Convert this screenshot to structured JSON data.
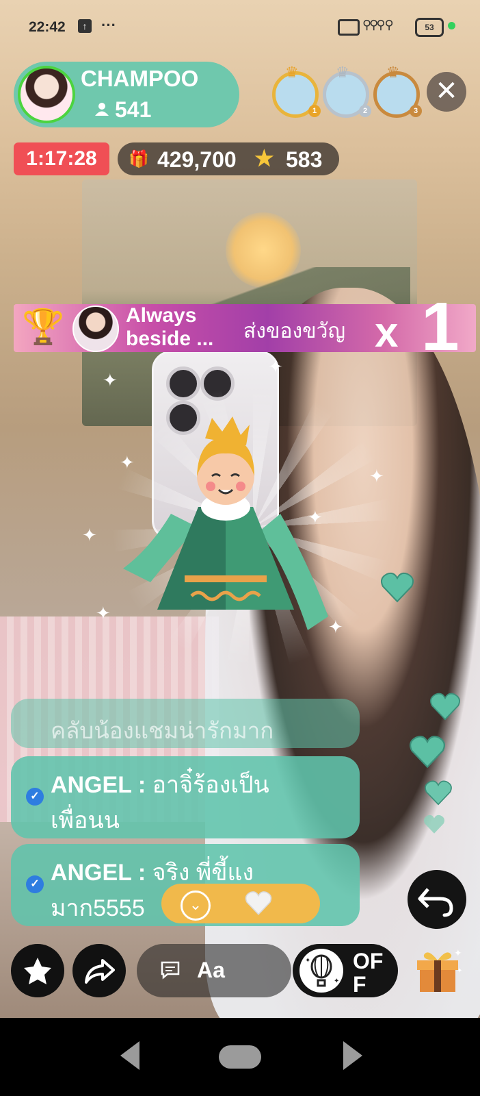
{
  "status_bar": {
    "time": "22:42",
    "more": "···",
    "battery": "53"
  },
  "host": {
    "name": "CHAMPOO",
    "viewer_count": "541"
  },
  "top_ranks": [
    {
      "badge_color": "#e9a428",
      "badge": "1"
    },
    {
      "badge_color": "#b8c2cc",
      "badge": "2"
    },
    {
      "badge_color": "#c98a3e",
      "badge": "3"
    }
  ],
  "live_stats": {
    "duration": "1:17:28",
    "gift_total": "429,700",
    "star_total": "583"
  },
  "gift_banner": {
    "sender": "Always beside ...",
    "action": "ส่งของขวัญ",
    "multiplier": "x",
    "count": "1"
  },
  "chat": {
    "faded_message": "คลับน้องแชมน่ารักมาก",
    "messages": [
      {
        "user": "ANGEL",
        "separator": " : ",
        "text_line1": "อาจิ๋ร้องเป็น",
        "text_line2": "เพื่อนน"
      },
      {
        "user": "ANGEL",
        "separator": " : ",
        "text_line1": "จริง พี่ขี้แง",
        "text_line2": "มาก5555"
      }
    ]
  },
  "input_bar": {
    "font_label": "Aa"
  },
  "toggle": {
    "label": "OFF"
  },
  "colors": {
    "accent_teal": "#6fc8ad",
    "timer_red": "#f04f55",
    "pill_gold": "#f1b94b",
    "heart_teal": "#5cc0a4"
  }
}
